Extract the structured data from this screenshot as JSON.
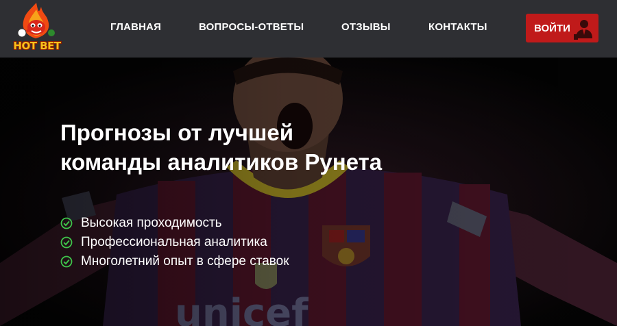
{
  "logo": {
    "text": "HOT BET"
  },
  "nav": {
    "items": [
      {
        "label": "ГЛАВНАЯ"
      },
      {
        "label": "ВОПРОСЫ-ОТВЕТЫ"
      },
      {
        "label": "ОТЗЫВЫ"
      },
      {
        "label": "КОНТАКТЫ"
      }
    ]
  },
  "login": {
    "label": "ВОЙТИ",
    "icon": "user-icon"
  },
  "hero": {
    "title_line1": "Прогнозы от лучшей",
    "title_line2": "команды аналитиков Рунета",
    "features": [
      {
        "text": "Высокая проходимость",
        "icon": "check-circle-icon"
      },
      {
        "text": "Профессиональная аналитика",
        "icon": "check-circle-icon"
      },
      {
        "text": "Многолетний опыт в сфере ставок",
        "icon": "check-circle-icon"
      }
    ],
    "background_text": "unicef"
  },
  "colors": {
    "header_bg": "#2e2f33",
    "login_bg": "#c01a1a",
    "check_green": "#3fc44a",
    "logo_yellow": "#f6c21c"
  }
}
